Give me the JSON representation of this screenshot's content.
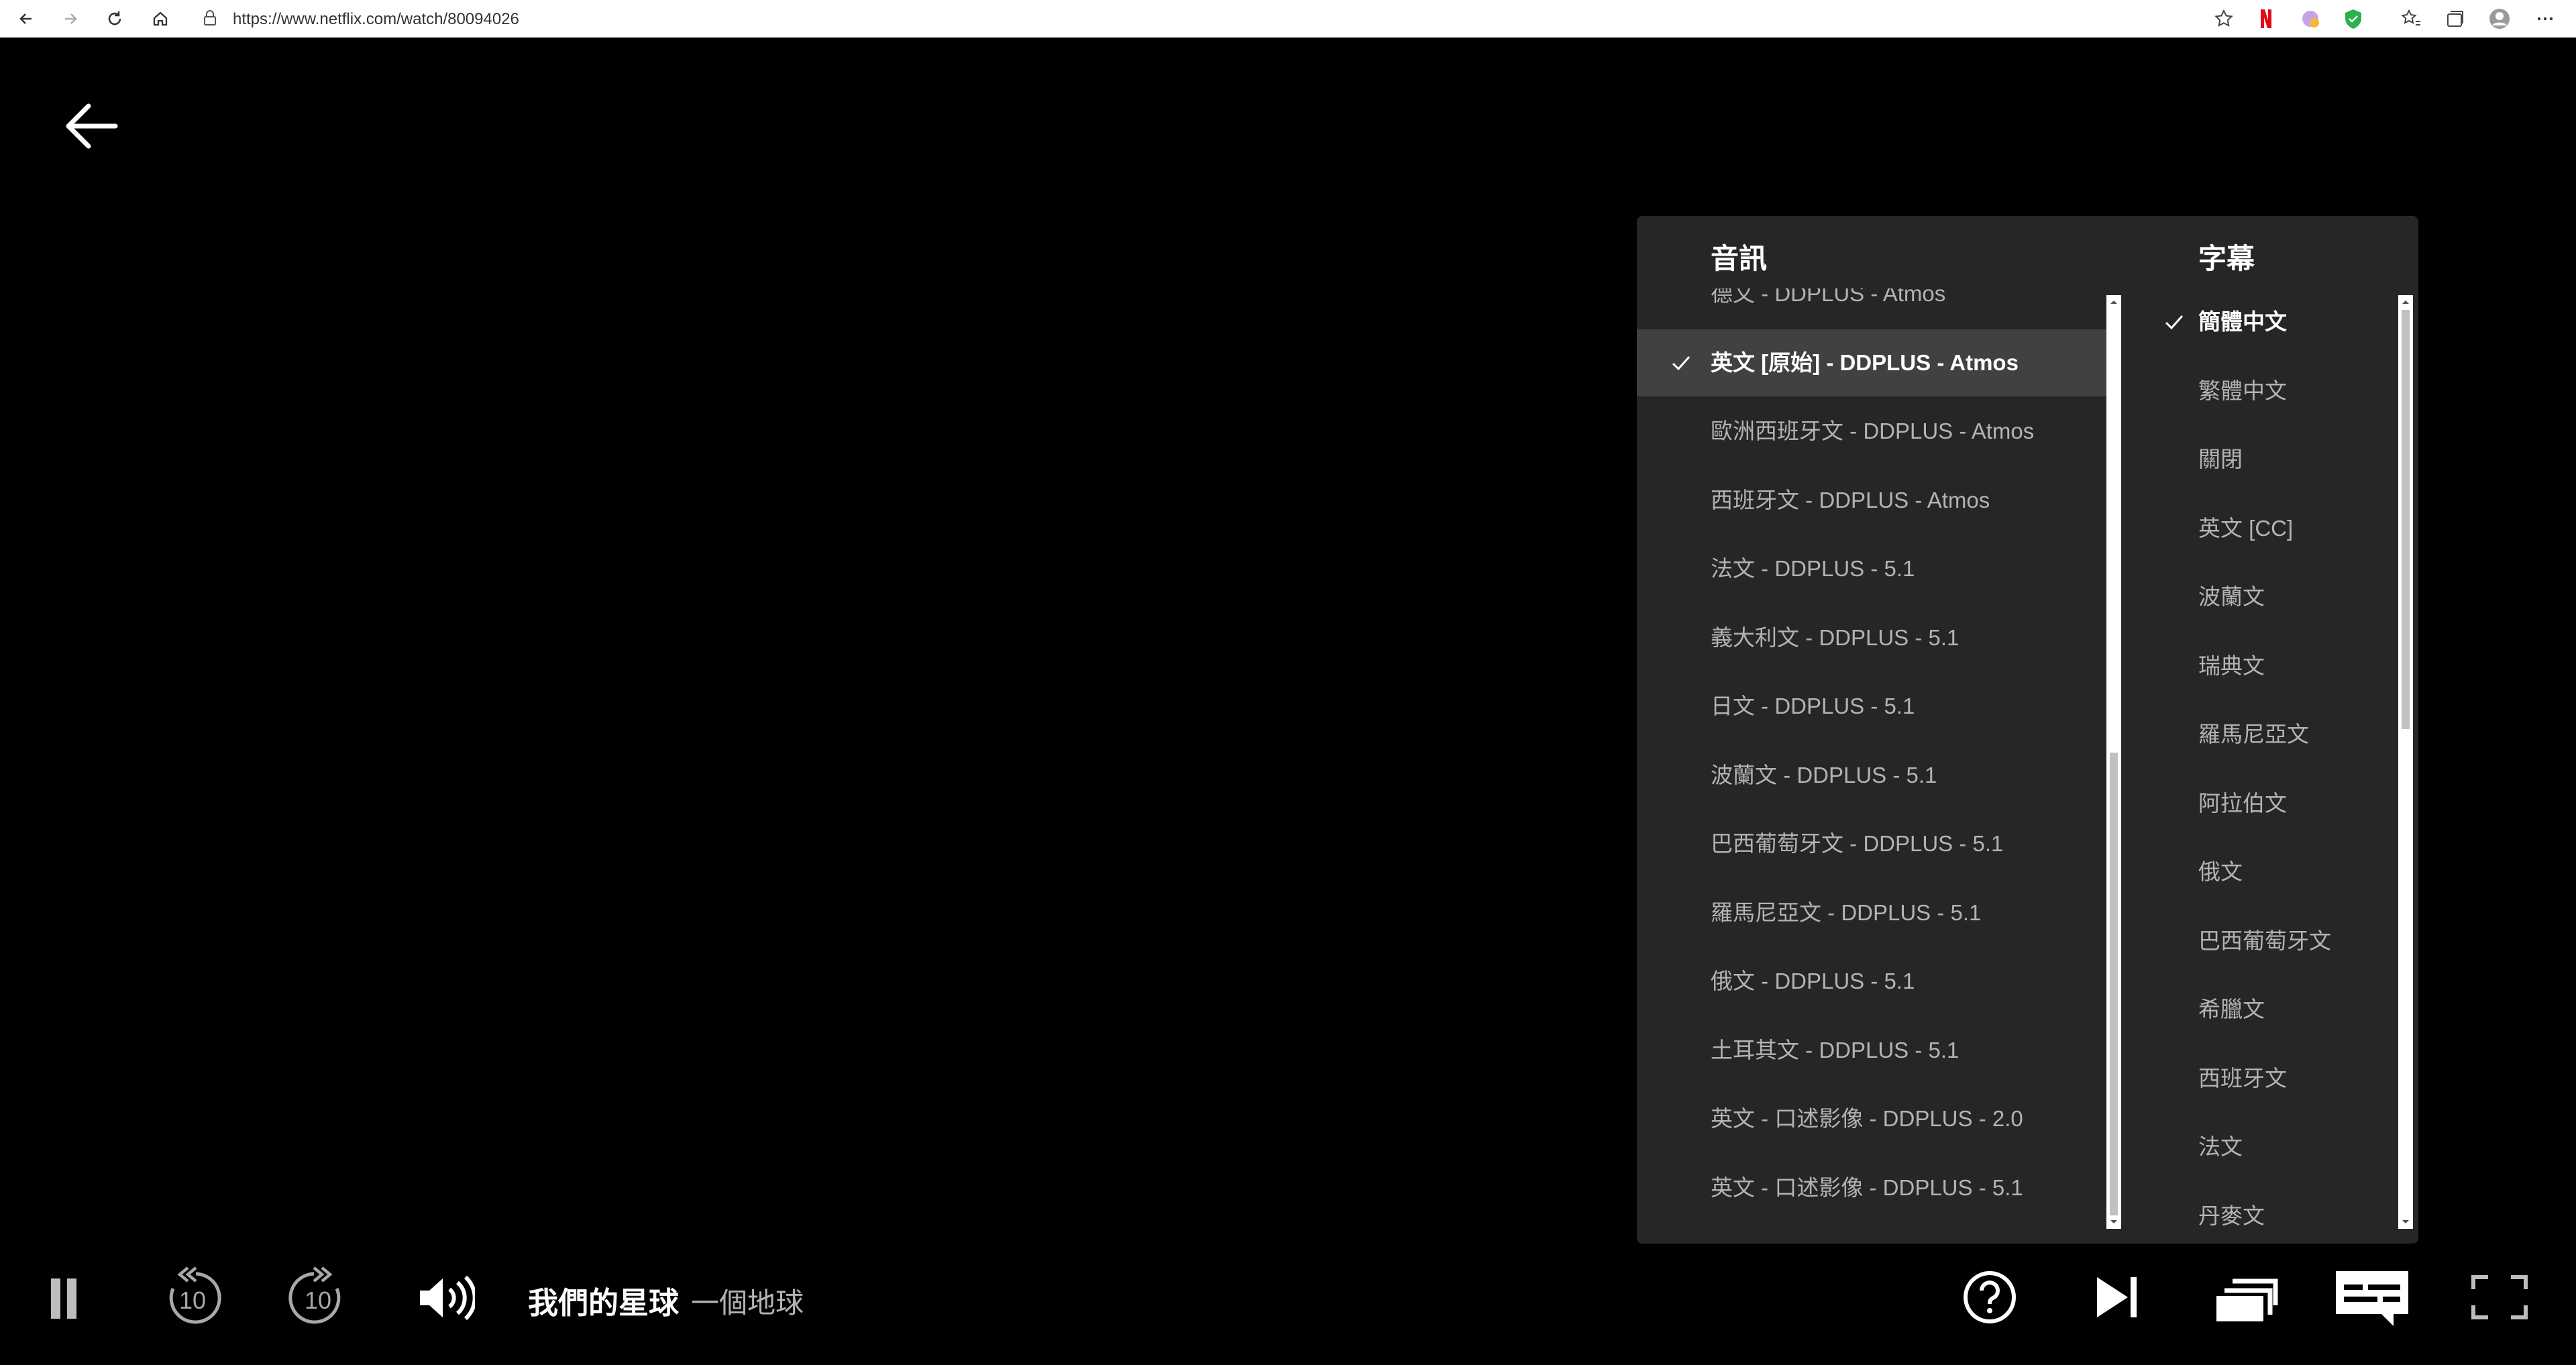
{
  "browser": {
    "url": "https://www.netflix.com/watch/80094026"
  },
  "player": {
    "title": "我們的星球",
    "episode": "一個地球",
    "skip_back_seconds": "10",
    "skip_forward_seconds": "10"
  },
  "audio": {
    "heading": "音訊",
    "items": [
      {
        "label": "德文 - DDPLUS - Atmos"
      },
      {
        "label": "英文 [原始] - DDPLUS - Atmos",
        "selected": true
      },
      {
        "label": "歐洲西班牙文 - DDPLUS - Atmos"
      },
      {
        "label": "西班牙文 - DDPLUS - Atmos"
      },
      {
        "label": "法文 - DDPLUS - 5.1"
      },
      {
        "label": "義大利文 - DDPLUS - 5.1"
      },
      {
        "label": "日文 - DDPLUS - 5.1"
      },
      {
        "label": "波蘭文 - DDPLUS - 5.1"
      },
      {
        "label": "巴西葡萄牙文 - DDPLUS - 5.1"
      },
      {
        "label": "羅馬尼亞文 - DDPLUS - 5.1"
      },
      {
        "label": "俄文 - DDPLUS - 5.1"
      },
      {
        "label": "土耳其文 - DDPLUS - 5.1"
      },
      {
        "label": "英文 - 口述影像 - DDPLUS - 2.0"
      },
      {
        "label": "英文 - 口述影像 - DDPLUS - 5.1"
      }
    ]
  },
  "subtitles": {
    "heading": "字幕",
    "items": [
      {
        "label": "簡體中文",
        "selected": true
      },
      {
        "label": "繁體中文"
      },
      {
        "label": "關閉"
      },
      {
        "label": "英文 [CC]"
      },
      {
        "label": "波蘭文"
      },
      {
        "label": "瑞典文"
      },
      {
        "label": "羅馬尼亞文"
      },
      {
        "label": "阿拉伯文"
      },
      {
        "label": "俄文"
      },
      {
        "label": "巴西葡萄牙文"
      },
      {
        "label": "希臘文"
      },
      {
        "label": "西班牙文"
      },
      {
        "label": "法文"
      },
      {
        "label": "丹麥文"
      }
    ]
  },
  "colors": {
    "panel_bg": "#262626",
    "highlight_bg": "#414141",
    "netflix_red": "#e50914"
  }
}
